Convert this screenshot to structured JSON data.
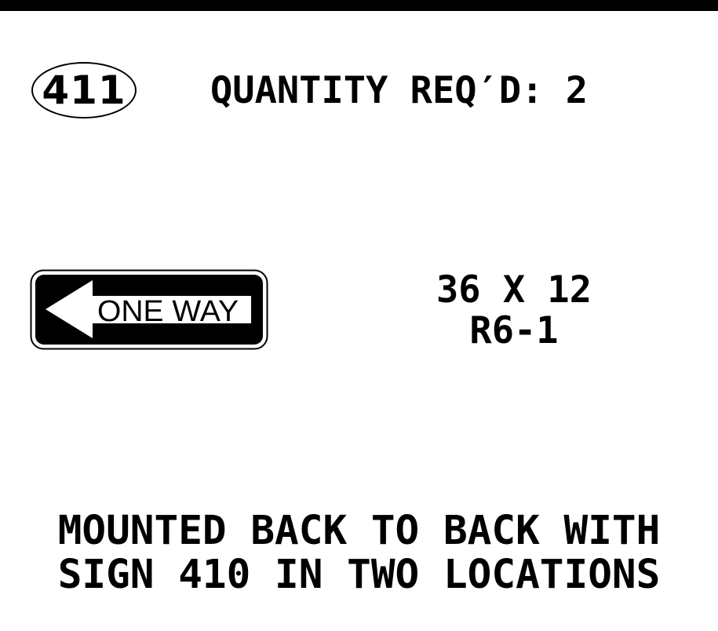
{
  "header": {
    "sign_number": "411",
    "quantity_text": "QUANTITY REQ′D: 2"
  },
  "sign": {
    "legend": "ONE WAY",
    "arrow_direction": "left",
    "colors": {
      "background": "#000000",
      "legend_panel": "#ffffff",
      "border": "#000000"
    }
  },
  "spec": {
    "size": "36 X 12",
    "code": "R6-1"
  },
  "note": {
    "line1": "MOUNTED BACK TO BACK WITH",
    "line2": "SIGN 410 IN TWO LOCATIONS"
  }
}
